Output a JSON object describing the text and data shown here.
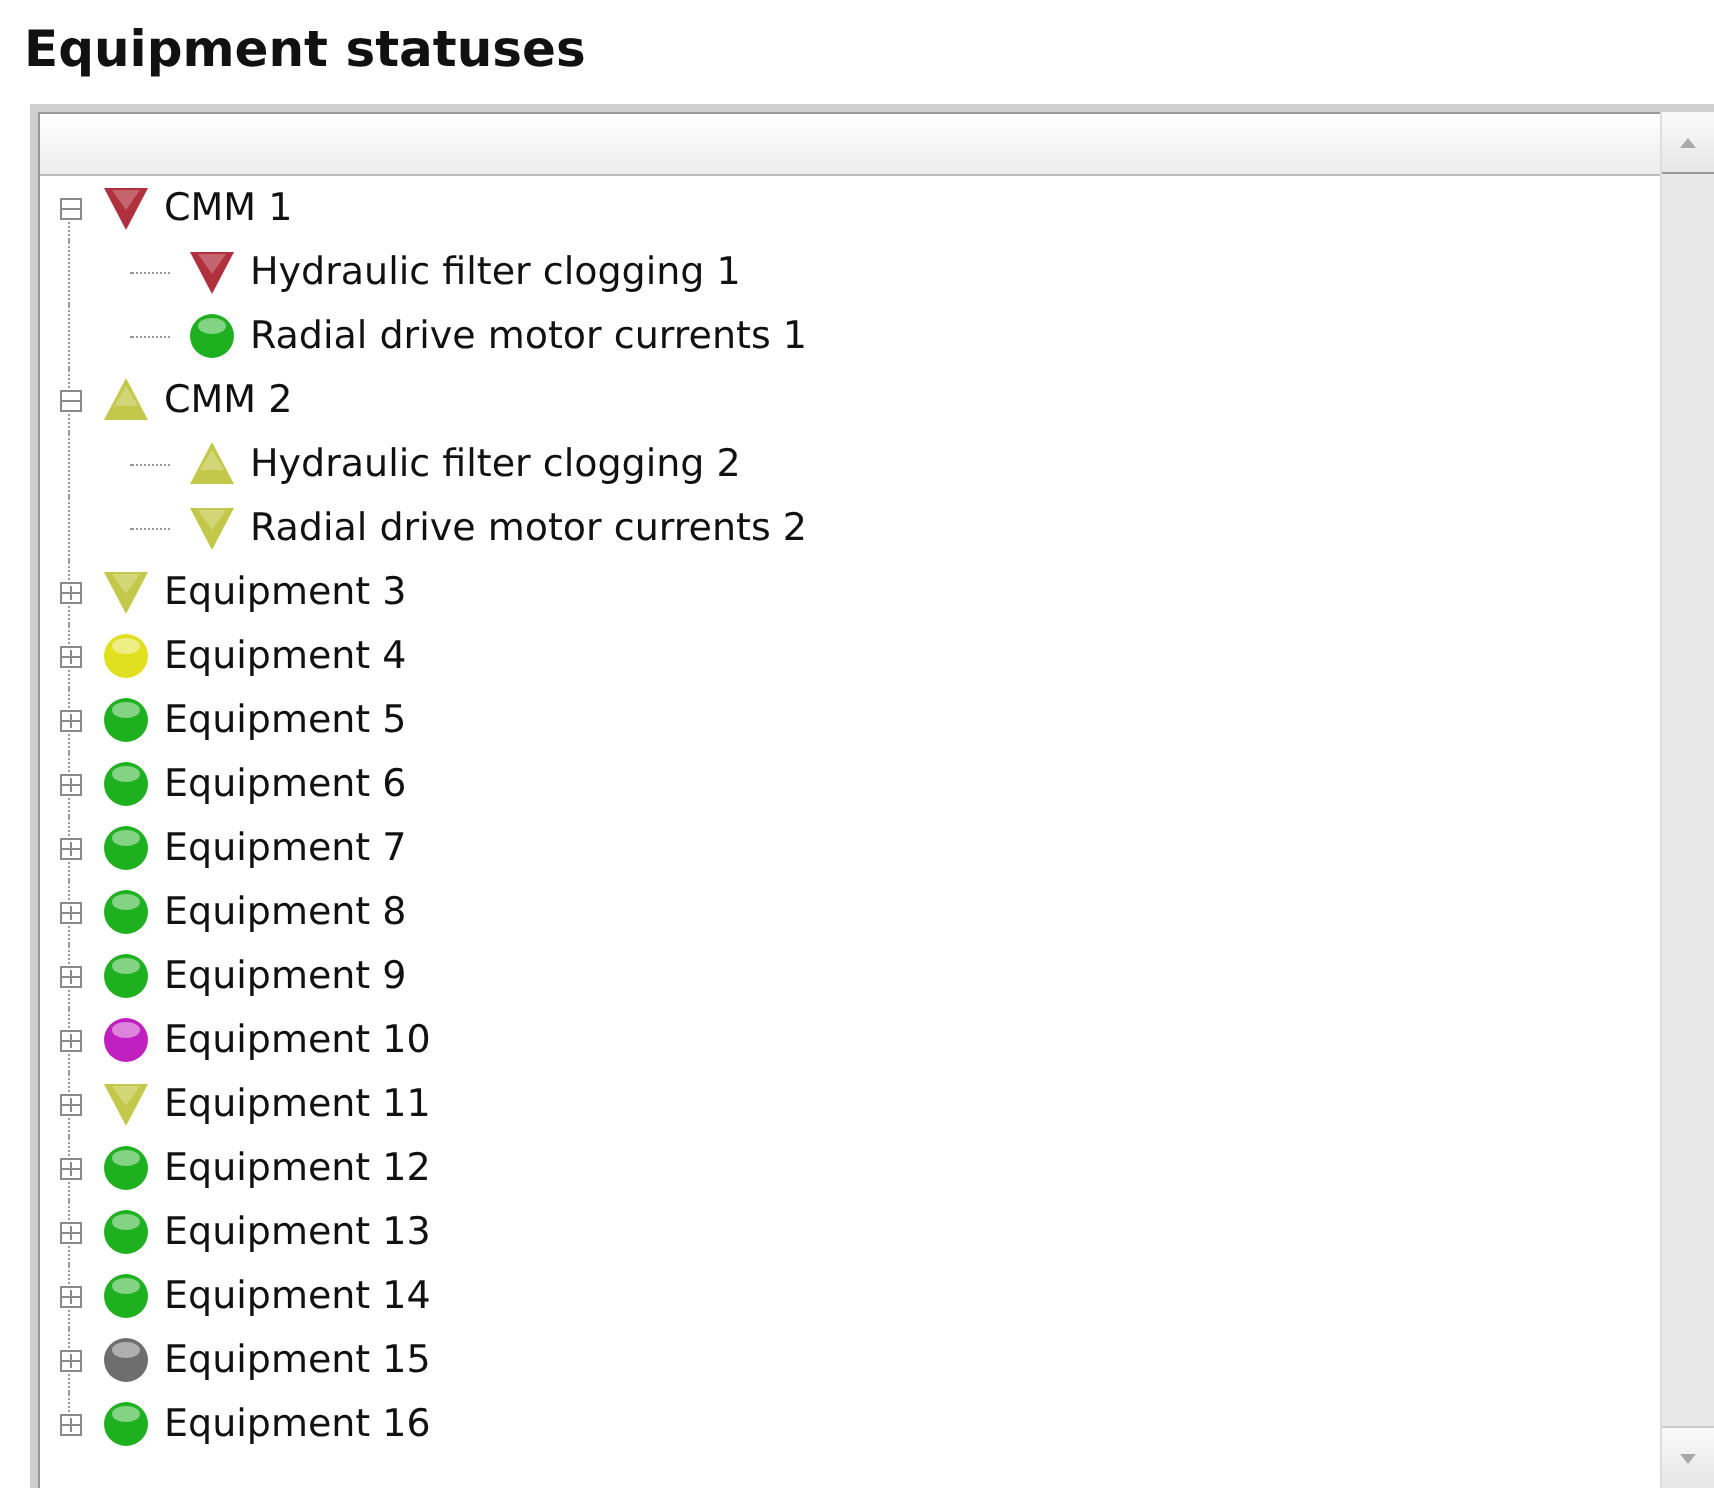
{
  "title": "Equipment statuses",
  "tree": [
    {
      "label": "CMM 1",
      "kind": "down",
      "color": "#b0303e",
      "expanded": true,
      "children": [
        {
          "label": "Hydraulic filter clogging 1",
          "kind": "down",
          "color": "#b0303e"
        },
        {
          "label": "Radial drive motor currents 1",
          "kind": "ball",
          "color": "#1fb01f"
        }
      ]
    },
    {
      "label": "CMM 2",
      "kind": "up",
      "color": "#c4c84a",
      "expanded": true,
      "children": [
        {
          "label": "Hydraulic filter clogging 2",
          "kind": "up",
          "color": "#c4c84a"
        },
        {
          "label": "Radial drive motor currents 2",
          "kind": "down",
          "color": "#c4c84a"
        }
      ]
    },
    {
      "label": "Equipment 3",
      "kind": "down",
      "color": "#c4c84a",
      "expanded": false
    },
    {
      "label": "Equipment 4",
      "kind": "ball",
      "color": "#e0e020",
      "expanded": false
    },
    {
      "label": "Equipment 5",
      "kind": "ball",
      "color": "#1fb01f",
      "expanded": false
    },
    {
      "label": "Equipment 6",
      "kind": "ball",
      "color": "#1fb01f",
      "expanded": false
    },
    {
      "label": "Equipment 7",
      "kind": "ball",
      "color": "#1fb01f",
      "expanded": false
    },
    {
      "label": "Equipment 8",
      "kind": "ball",
      "color": "#1fb01f",
      "expanded": false
    },
    {
      "label": "Equipment 9",
      "kind": "ball",
      "color": "#1fb01f",
      "expanded": false
    },
    {
      "label": "Equipment 10",
      "kind": "ball",
      "color": "#c020c0",
      "expanded": false
    },
    {
      "label": "Equipment 11",
      "kind": "down",
      "color": "#c4c84a",
      "expanded": false
    },
    {
      "label": "Equipment 12",
      "kind": "ball",
      "color": "#1fb01f",
      "expanded": false
    },
    {
      "label": "Equipment 13",
      "kind": "ball",
      "color": "#1fb01f",
      "expanded": false
    },
    {
      "label": "Equipment 14",
      "kind": "ball",
      "color": "#1fb01f",
      "expanded": false
    },
    {
      "label": "Equipment 15",
      "kind": "ball",
      "color": "#6e6e6e",
      "expanded": false
    },
    {
      "label": "Equipment 16",
      "kind": "ball",
      "color": "#1fb01f",
      "expanded": false
    }
  ]
}
